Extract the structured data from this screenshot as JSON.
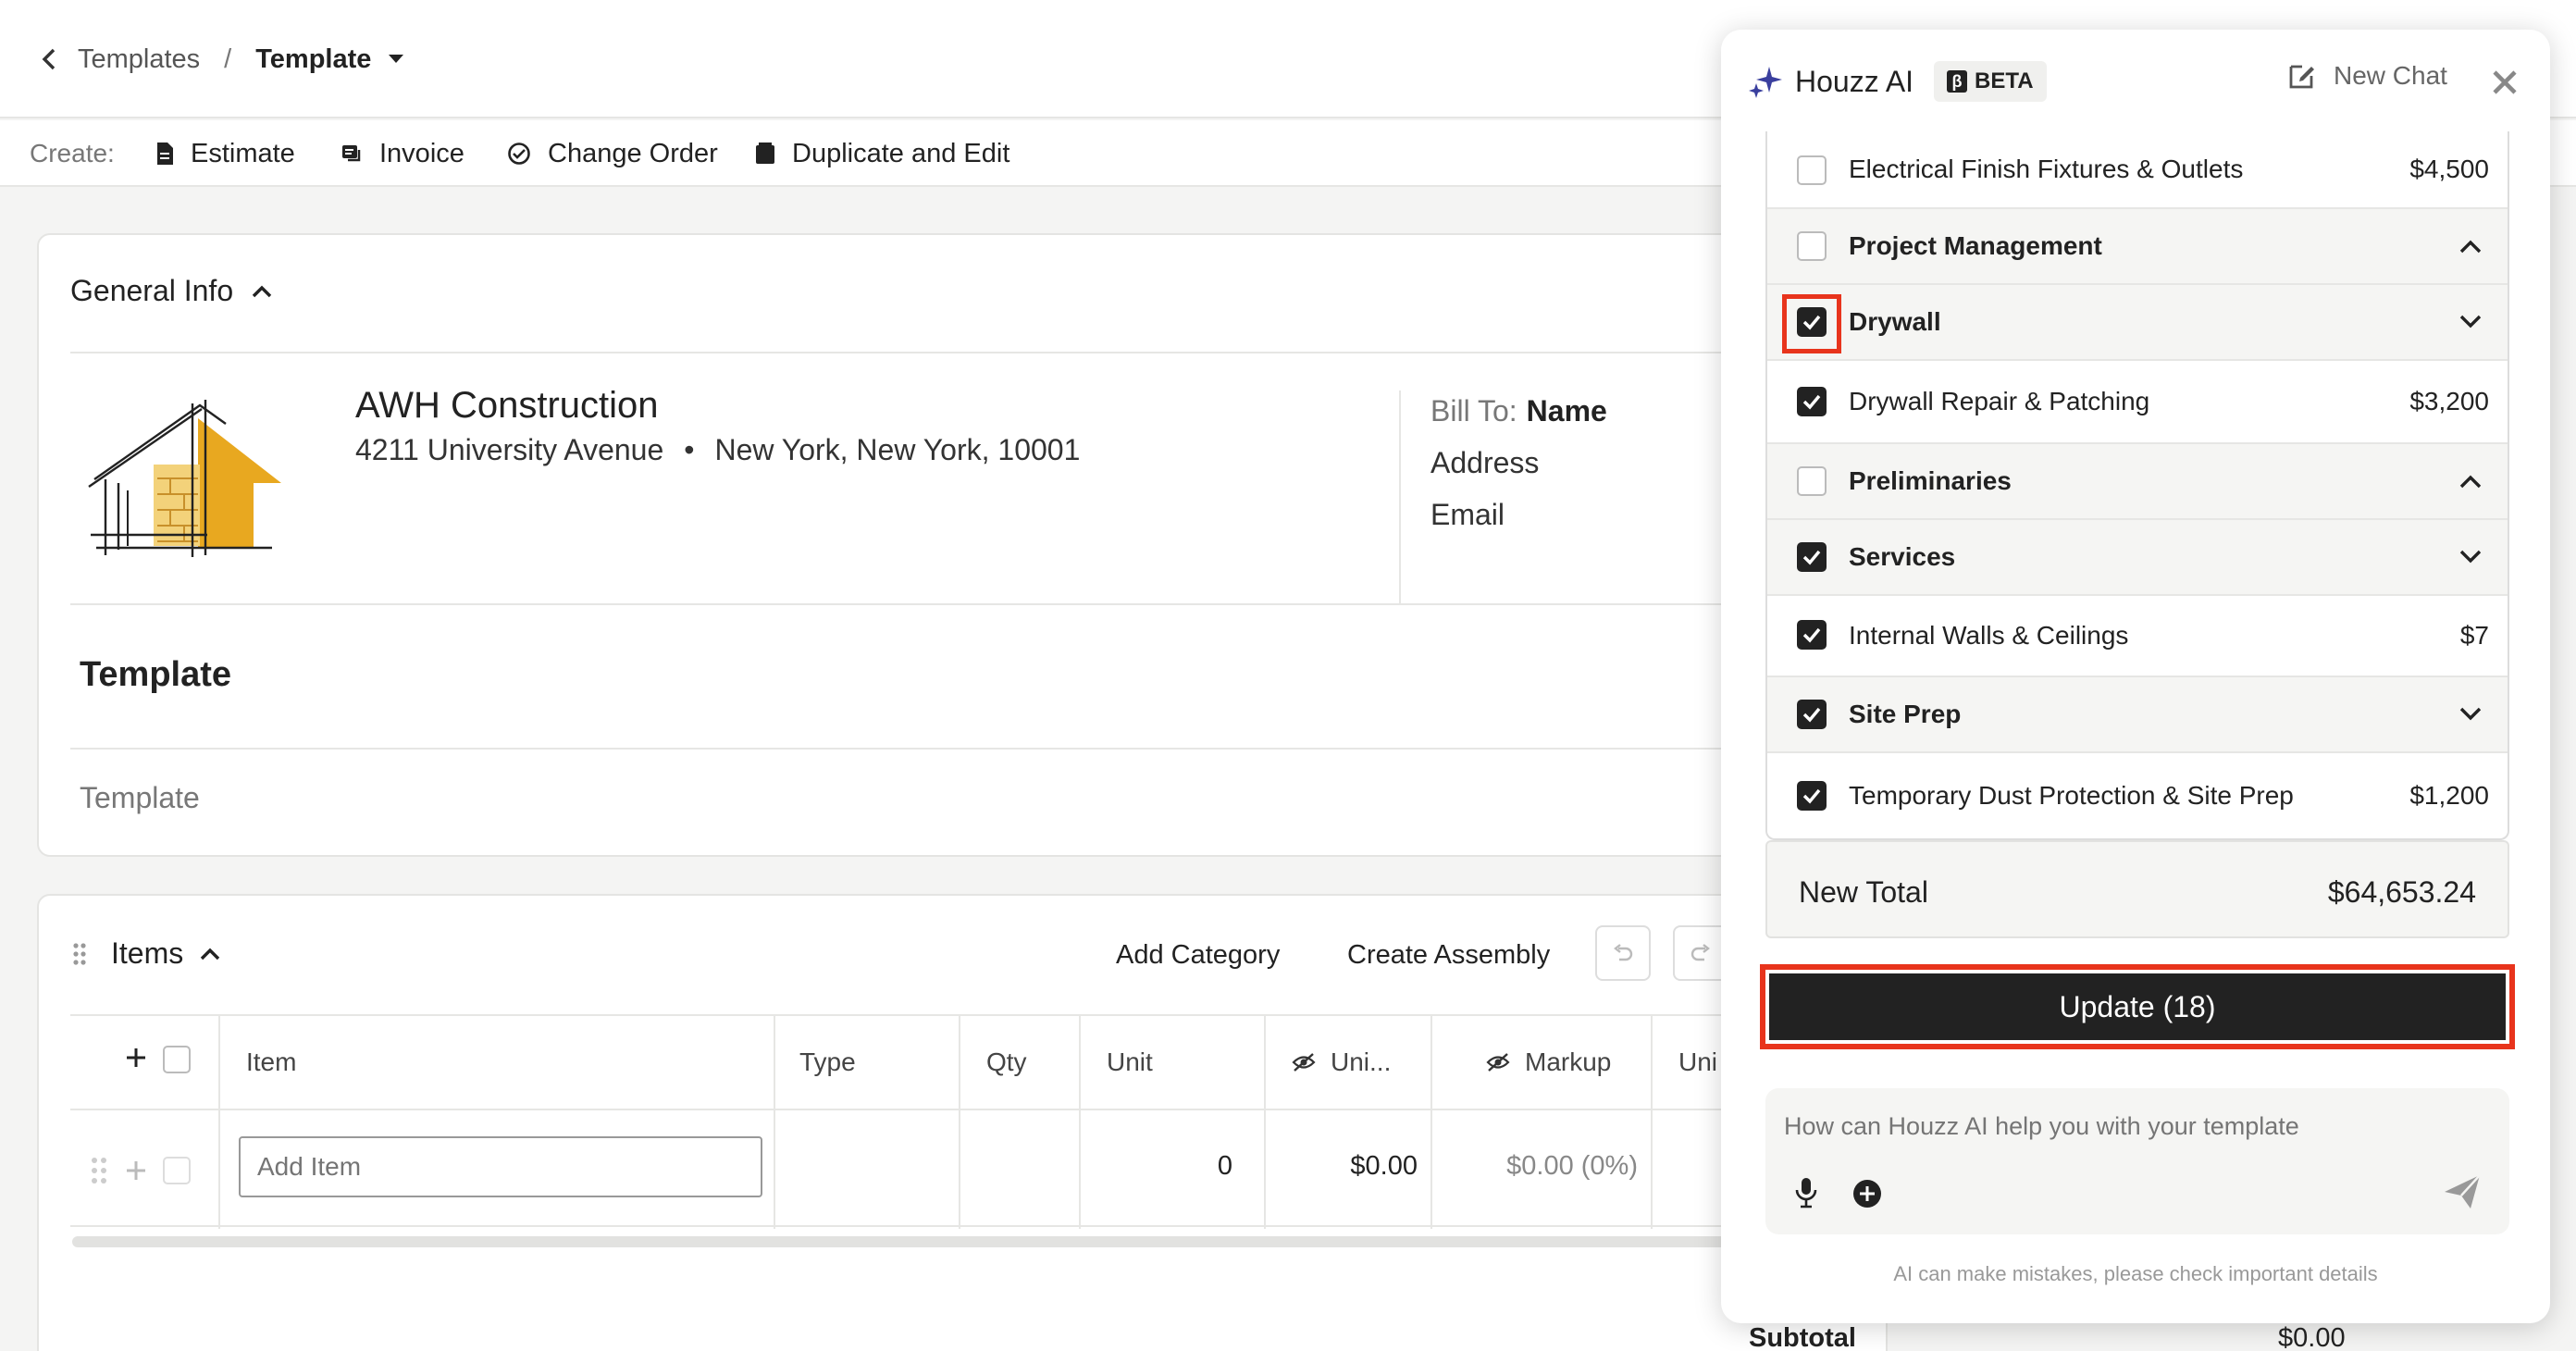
{
  "breadcrumb": {
    "parent": "Templates",
    "separator": "/",
    "current": "Template"
  },
  "create_bar": {
    "label": "Create:",
    "buttons": [
      "Estimate",
      "Invoice",
      "Change Order",
      "Duplicate and Edit"
    ]
  },
  "general_info": {
    "header": "General Info",
    "company_name": "AWH Construction",
    "address_street": "4211 University Avenue",
    "address_dot": "•",
    "address_city": "New York, New York, 10001",
    "bill_to_label": "Bill To:",
    "bill_to_name": "Name",
    "bill_to_address": "Address",
    "bill_to_email": "Email",
    "template_title": "Template",
    "template_subtitle": "Template"
  },
  "items_section": {
    "header": "Items",
    "add_category": "Add Category",
    "create_assembly": "Create Assembly",
    "columns": {
      "item": "Item",
      "type": "Type",
      "qty": "Qty",
      "unit": "Unit",
      "unit_cost": "Uni...",
      "markup": "Markup",
      "unit_price": "Uni"
    },
    "add_item_placeholder": "Add Item",
    "row": {
      "qty": "0",
      "unit_cost": "$0.00",
      "markup": "$0.00 (0%)"
    },
    "subtotal_label": "Subtotal",
    "subtotal_value": "$0.00"
  },
  "ai_panel": {
    "title": "Houzz AI",
    "badge_glyph": "β",
    "badge": "BETA",
    "new_chat": "New Chat",
    "list": [
      {
        "label": "Electrical Finish Fixtures & Outlets",
        "amount": "$4,500",
        "checked": false,
        "category": false
      },
      {
        "label": "Project Management",
        "checked": false,
        "category": true,
        "expanded": true
      },
      {
        "label": "Drywall",
        "checked": true,
        "category": true,
        "expanded": false,
        "highlighted": true
      },
      {
        "label": "Drywall Repair & Patching",
        "amount": "$3,200",
        "checked": true,
        "category": false
      },
      {
        "label": "Preliminaries",
        "checked": false,
        "category": true,
        "expanded": true
      },
      {
        "label": "Services",
        "checked": true,
        "category": true,
        "expanded": false
      },
      {
        "label": "Internal Walls & Ceilings",
        "amount": "$7",
        "checked": true,
        "category": false
      },
      {
        "label": "Site Prep",
        "checked": true,
        "category": true,
        "expanded": false
      },
      {
        "label": "Temporary Dust Protection & Site Prep",
        "amount": "$1,200",
        "checked": true,
        "category": false
      }
    ],
    "new_total_label": "New Total",
    "new_total_value": "$64,653.24",
    "update_button": "Update (18)",
    "input_placeholder": "How can Houzz AI help you with your template",
    "disclaimer": "AI can make mistakes, please check important details"
  },
  "colors": {
    "highlight": "#e8341c",
    "dark": "#222222",
    "accent": "#3a3f9e",
    "logo_yellow": "#e8a820"
  }
}
